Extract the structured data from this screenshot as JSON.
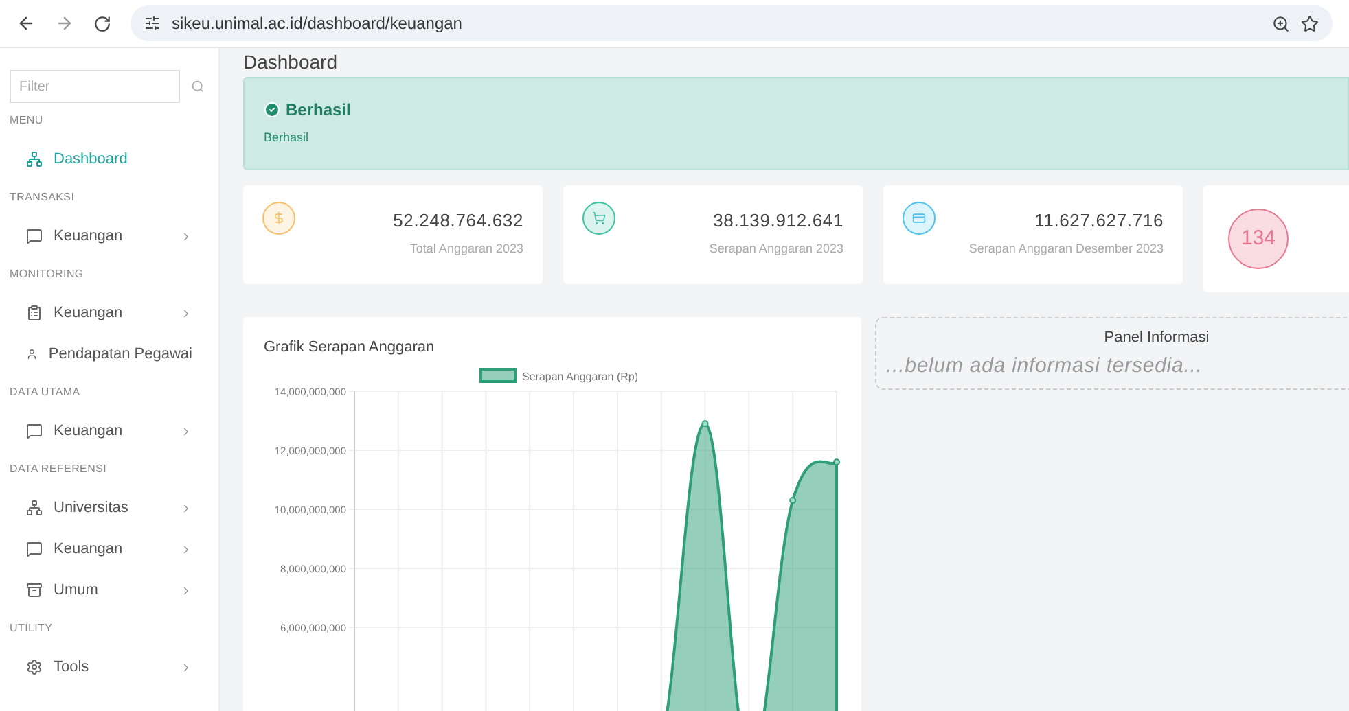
{
  "browser": {
    "url": "sikeu.unimal.ac.id/dashboard/keuangan"
  },
  "sidebar": {
    "filter_placeholder": "Filter",
    "items": [
      {
        "kind": "section",
        "label": "MENU"
      },
      {
        "kind": "item",
        "label": "Dashboard",
        "selected": true,
        "has_children": false
      },
      {
        "kind": "section",
        "label": "TRANSAKSI"
      },
      {
        "kind": "item",
        "label": "Keuangan",
        "selected": false,
        "has_children": true
      },
      {
        "kind": "section",
        "label": "MONITORING"
      },
      {
        "kind": "item",
        "label": "Keuangan",
        "selected": false,
        "has_children": true
      },
      {
        "kind": "item",
        "label": "Pendapatan Pegawai",
        "selected": false,
        "has_children": false
      },
      {
        "kind": "section",
        "label": "DATA UTAMA"
      },
      {
        "kind": "item",
        "label": "Keuangan",
        "selected": false,
        "has_children": true
      },
      {
        "kind": "section",
        "label": "DATA REFERENSI"
      },
      {
        "kind": "item",
        "label": "Universitas",
        "selected": false,
        "has_children": true
      },
      {
        "kind": "item",
        "label": "Keuangan",
        "selected": false,
        "has_children": true
      },
      {
        "kind": "item",
        "label": "Umum",
        "selected": false,
        "has_children": true
      },
      {
        "kind": "section",
        "label": "UTILITY"
      },
      {
        "kind": "item",
        "label": "Tools",
        "selected": false,
        "has_children": true
      }
    ]
  },
  "page_title": "Dashboard",
  "alert": {
    "title": "Berhasil",
    "message": "Berhasil"
  },
  "stats": [
    {
      "kind": "amount",
      "color": "#f5c26b",
      "value": "52.248.764.632",
      "label": "Total Anggaran 2023"
    },
    {
      "kind": "amount",
      "color": "#3ec3a4",
      "value": "38.139.912.641",
      "label": "Serapan Anggaran 2023"
    },
    {
      "kind": "amount",
      "color": "#4fc3e8",
      "value": "11.627.627.716",
      "label": "Serapan Anggaran Desember 2023"
    },
    {
      "kind": "count",
      "color": "#e8778f",
      "value": "134"
    }
  ],
  "chart_panel": {
    "title": "Grafik Serapan Anggaran",
    "chart_data": {
      "type": "area",
      "grid": true,
      "ylim": [
        0,
        14000000000
      ],
      "yticks": [
        {
          "value": 6000000000,
          "label": "6,000,000,000"
        },
        {
          "value": 8000000000,
          "label": "8,000,000,000"
        },
        {
          "value": 10000000000,
          "label": "10,000,000,000"
        },
        {
          "value": 12000000000,
          "label": "12,000,000,000"
        },
        {
          "value": 14000000000,
          "label": "14,000,000,000"
        }
      ],
      "series": [
        {
          "name": "Serapan Anggaran (Rp)",
          "color": "#2e9e7a",
          "values": [
            0,
            0,
            0,
            0,
            0,
            0,
            0,
            2000000000,
            12900000000,
            1500000000,
            10300000000,
            11600000000
          ]
        }
      ]
    }
  },
  "info_panel": {
    "title": "Panel Informasi",
    "message": "...belum ada informasi tersedia..."
  }
}
